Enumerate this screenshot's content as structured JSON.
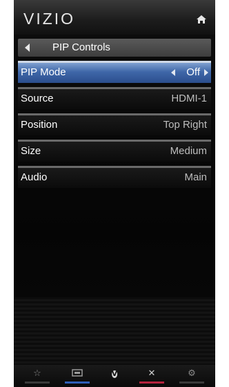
{
  "header": {
    "logo": "VIZIO",
    "home_icon": "home-icon"
  },
  "breadcrumb": {
    "title": "PIP Controls",
    "back_icon": "left-triangle-icon"
  },
  "menu": {
    "items": [
      {
        "label": "PIP Mode",
        "value": "Off",
        "selected": true
      },
      {
        "label": "Source",
        "value": "HDMI-1",
        "selected": false
      },
      {
        "label": "Position",
        "value": "Top Right",
        "selected": false
      },
      {
        "label": "Size",
        "value": "Medium",
        "selected": false
      },
      {
        "label": "Audio",
        "value": "Main",
        "selected": false
      }
    ]
  },
  "footer": {
    "buttons": [
      {
        "icon": "star-icon",
        "accent": "#3a3a3a"
      },
      {
        "icon": "input-icon",
        "accent": "#2f5fb8"
      },
      {
        "icon": "vizio-v-icon",
        "accent": "#3a3a3a"
      },
      {
        "icon": "close-icon",
        "accent": "#b4233e"
      },
      {
        "icon": "gear-icon",
        "accent": "#3a3a3a"
      }
    ]
  },
  "colors": {
    "selected_row": "#3f67a8",
    "background": "#050505"
  }
}
